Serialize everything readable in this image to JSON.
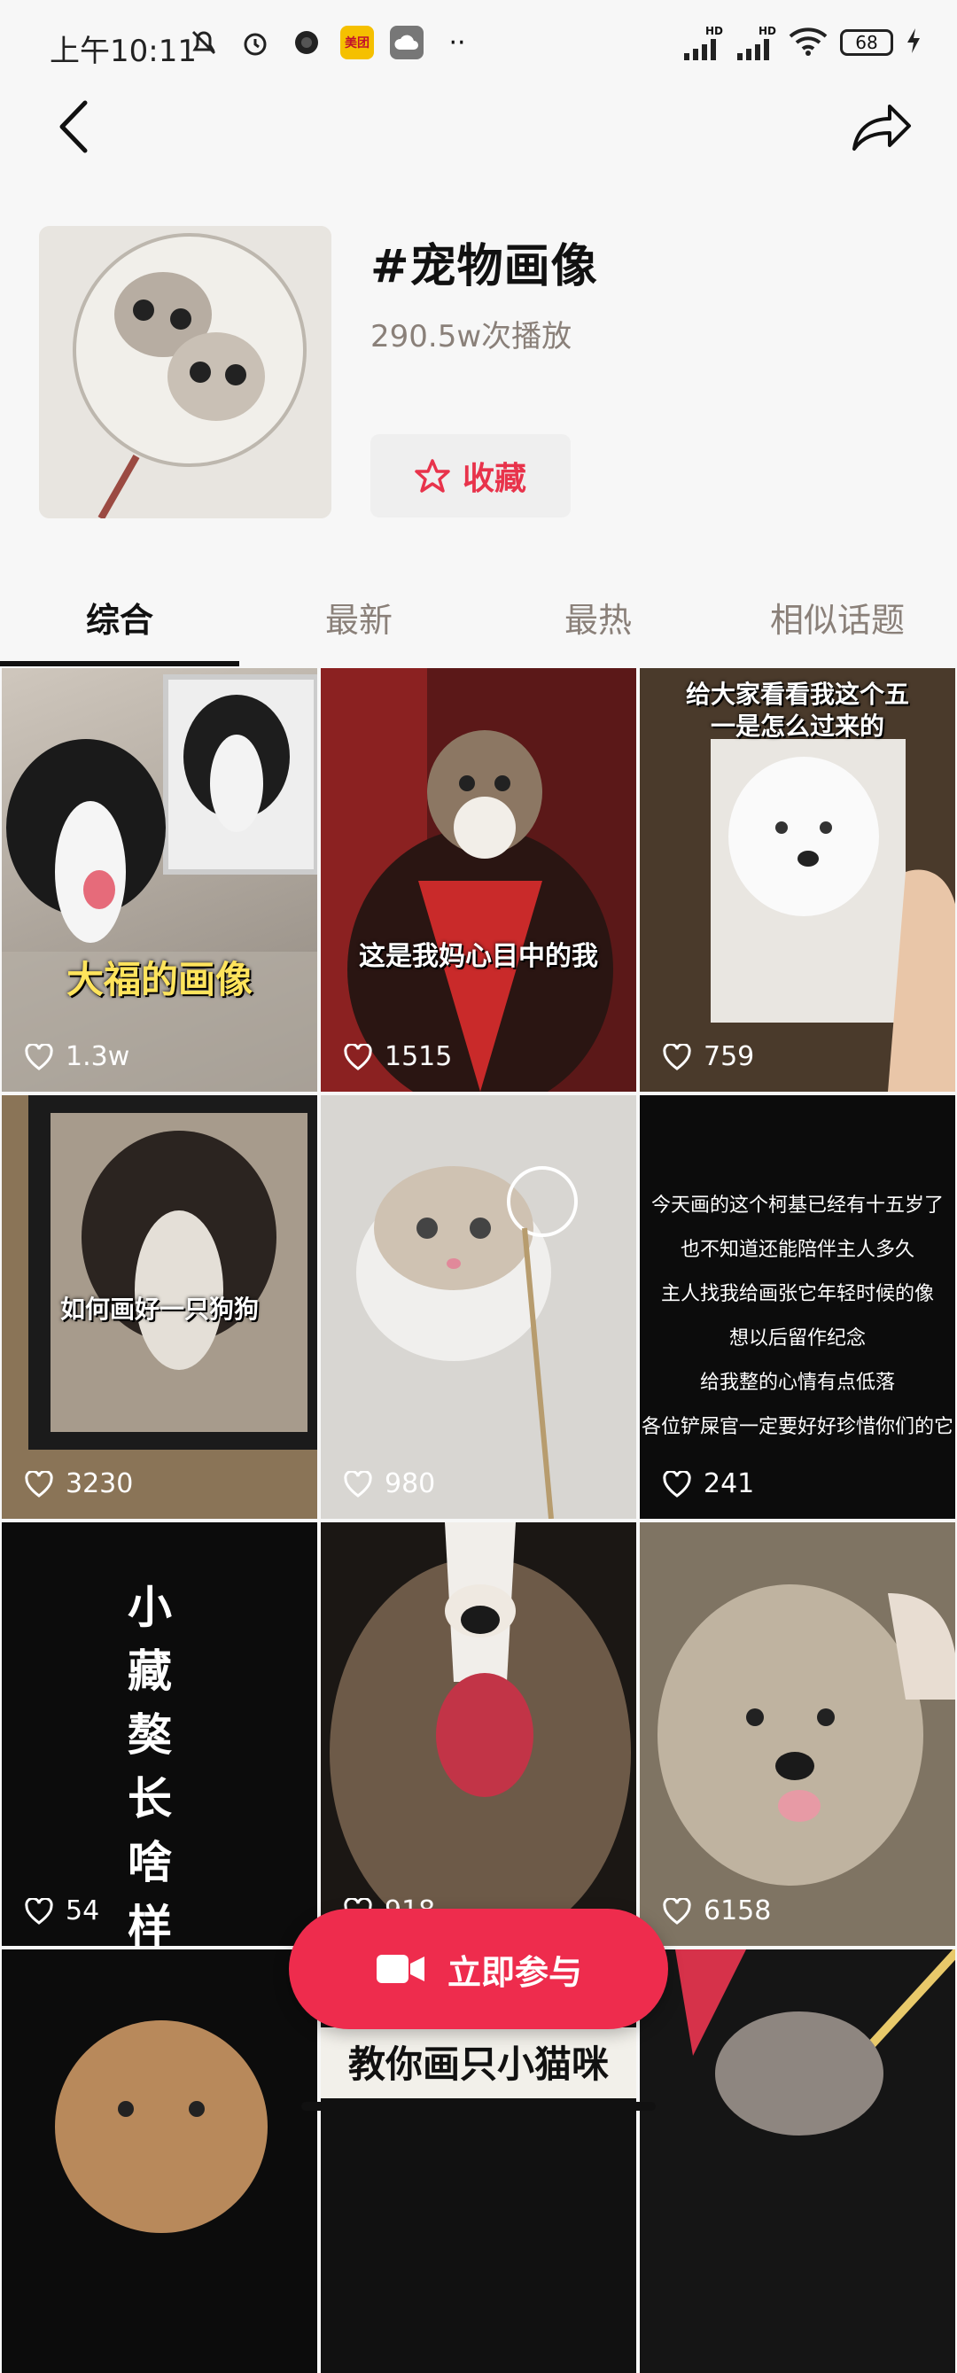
{
  "status_bar": {
    "time": "上午10:11",
    "app_badge": "美团",
    "network_1": "HD",
    "network_2": "HD",
    "battery": "68"
  },
  "topic": {
    "title": "#宠物画像",
    "plays": "290.5w次播放",
    "favorite_label": "收藏"
  },
  "tabs": [
    {
      "label": "综合",
      "active": true
    },
    {
      "label": "最新",
      "active": false
    },
    {
      "label": "最热",
      "active": false
    },
    {
      "label": "相似话题",
      "active": false
    }
  ],
  "grid": [
    {
      "likes": "1.3w",
      "caption": "大福的画像"
    },
    {
      "likes": "1515",
      "caption": "这是我妈心目中的我"
    },
    {
      "likes": "759",
      "caption": "给大家看看我这个五一是怎么过来的"
    },
    {
      "likes": "3230",
      "caption": "如何画好一只狗狗"
    },
    {
      "likes": "980",
      "caption": ""
    },
    {
      "likes": "241",
      "lines": [
        "今天画的这个柯基已经有十五岁了",
        "也不知道还能陪伴主人多久",
        "主人找我给画张它年轻时候的像",
        "想以后留作纪念",
        "给我整的心情有点低落",
        "各位铲屎官一定要好好珍惜你们的它"
      ]
    },
    {
      "likes": "54",
      "vertical": "小藏獒长啥样"
    },
    {
      "likes": "918",
      "caption": ""
    },
    {
      "likes": "6158",
      "caption": ""
    },
    {
      "likes": "",
      "caption": ""
    },
    {
      "likes": "",
      "caption": "教你画只小猫咪"
    },
    {
      "likes": "",
      "caption": ""
    }
  ],
  "cta": {
    "label": "立即参与"
  }
}
